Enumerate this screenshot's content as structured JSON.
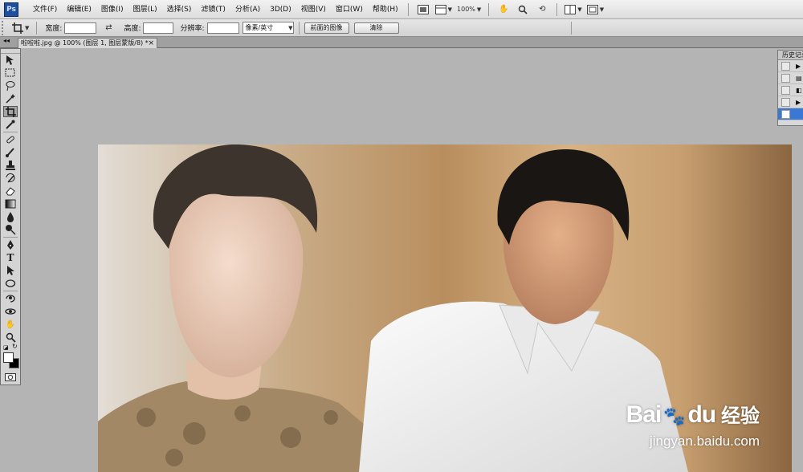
{
  "app": {
    "logo": "Ps"
  },
  "menu": [
    "文件(F)",
    "编辑(E)",
    "图像(I)",
    "图层(L)",
    "选择(S)",
    "滤镜(T)",
    "分析(A)",
    "3D(D)",
    "视图(V)",
    "窗口(W)",
    "帮助(H)"
  ],
  "menubar_tools": {
    "zoom_level": "100%"
  },
  "options": {
    "width_label": "宽度:",
    "height_label": "高度:",
    "resolution_label": "分辨率:",
    "units_select": "像素/英寸",
    "front_image_button": "前面的图像",
    "clear_button": "清除"
  },
  "document": {
    "tab_title": "啦啦啦.jpg @ 100% (图层 1, 图层蒙版/8) *",
    "close": "×"
  },
  "history": {
    "title": "历史记录"
  },
  "tools": [
    "move-tool",
    "marquee-tool",
    "lasso-tool",
    "magic-wand-tool",
    "crop-tool",
    "eyedropper-tool",
    "healing-brush-tool",
    "brush-tool",
    "clone-stamp-tool",
    "history-brush-tool",
    "eraser-tool",
    "gradient-tool",
    "blur-tool",
    "dodge-tool",
    "pen-tool",
    "type-tool",
    "path-selection-tool",
    "shape-tool",
    "3d-rotate-tool",
    "3d-orbit-tool",
    "hand-tool",
    "zoom-tool"
  ],
  "watermark": {
    "brand": "Bai",
    "brand_suffix": "du",
    "brand_cn": "经验",
    "url": "jingyan.baidu.com"
  }
}
